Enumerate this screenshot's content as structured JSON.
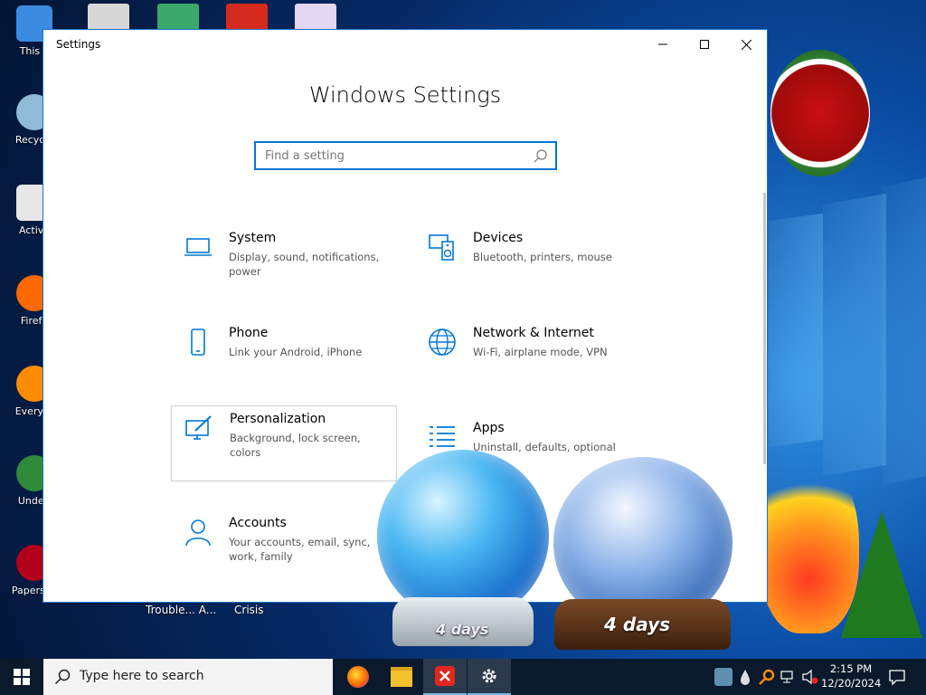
{
  "desktop": {
    "icons": [
      {
        "label": "This P",
        "color": "#3b8be0"
      },
      {
        "label": "Recycle",
        "color": "#8fbad8"
      },
      {
        "label": "Activa",
        "color": "#e7e7e7"
      },
      {
        "label": "Firefo",
        "color": "#ff6a00"
      },
      {
        "label": "Everyth",
        "color": "#ff8c00"
      },
      {
        "label": "Underl",
        "color": "#2f8a3a"
      },
      {
        "label": "Papers, F",
        "color": "#b3001b"
      }
    ],
    "behind_window_labels": [
      "Trouble... A...",
      "Crisis"
    ],
    "globe_left_text": "4 days",
    "globe_right_text": "4 days"
  },
  "window": {
    "title": "Settings",
    "heading": "Windows Settings",
    "search_placeholder": "Find a setting",
    "tiles": [
      {
        "name": "System",
        "desc": "Display, sound, notifications, power",
        "icon": "laptop-icon"
      },
      {
        "name": "Devices",
        "desc": "Bluetooth, printers, mouse",
        "icon": "keyboard-speaker-icon"
      },
      {
        "name": "Phone",
        "desc": "Link your Android, iPhone",
        "icon": "phone-icon"
      },
      {
        "name": "Network & Internet",
        "desc": "Wi-Fi, airplane mode, VPN",
        "icon": "globe-icon"
      },
      {
        "name": "Personalization",
        "desc": "Background, lock screen, colors",
        "icon": "paint-icon"
      },
      {
        "name": "Apps",
        "desc": "Uninstall, defaults, optional",
        "icon": "apps-list-icon"
      },
      {
        "name": "Accounts",
        "desc": "Your accounts, email, sync, work, family",
        "icon": "person-icon"
      }
    ]
  },
  "taskbar": {
    "search_placeholder": "Type here to search",
    "time": "2:15 PM",
    "date": "12/20/2024"
  },
  "colors": {
    "accent": "#0078d4",
    "taskbar": "#0a1a2c"
  }
}
